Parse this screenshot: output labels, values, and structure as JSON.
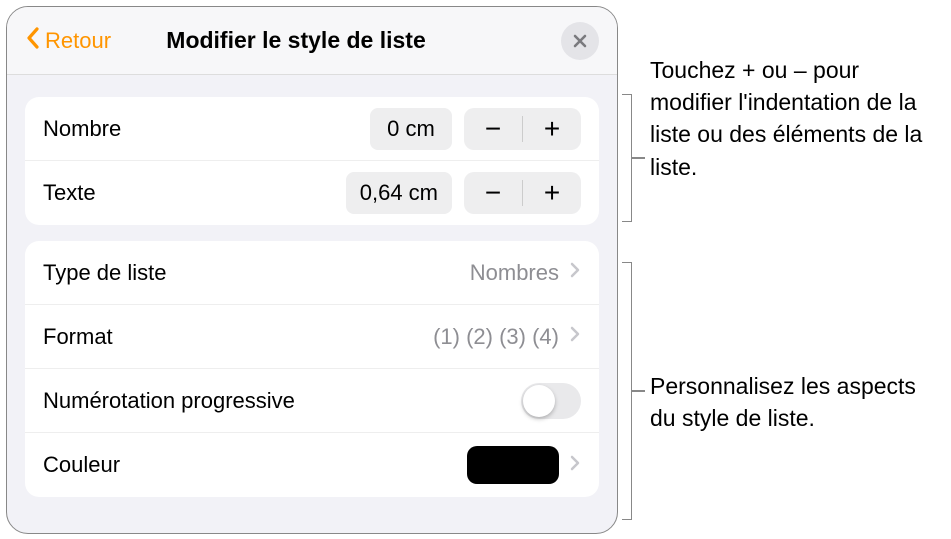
{
  "header": {
    "back": "Retour",
    "title": "Modifier le style de liste"
  },
  "indent": {
    "number_label": "Nombre",
    "number_value": "0 cm",
    "text_label": "Texte",
    "text_value": "0,64 cm"
  },
  "list": {
    "type_label": "Type de liste",
    "type_value": "Nombres",
    "format_label": "Format",
    "format_value": "(1) (2) (3) (4)",
    "progressive_label": "Numérotation progressive",
    "color_label": "Couleur"
  },
  "callouts": {
    "c1": "Touchez + ou – pour modifier l'indentation de la liste ou des éléments de la liste.",
    "c2": "Personnalisez les aspects du style de liste."
  }
}
